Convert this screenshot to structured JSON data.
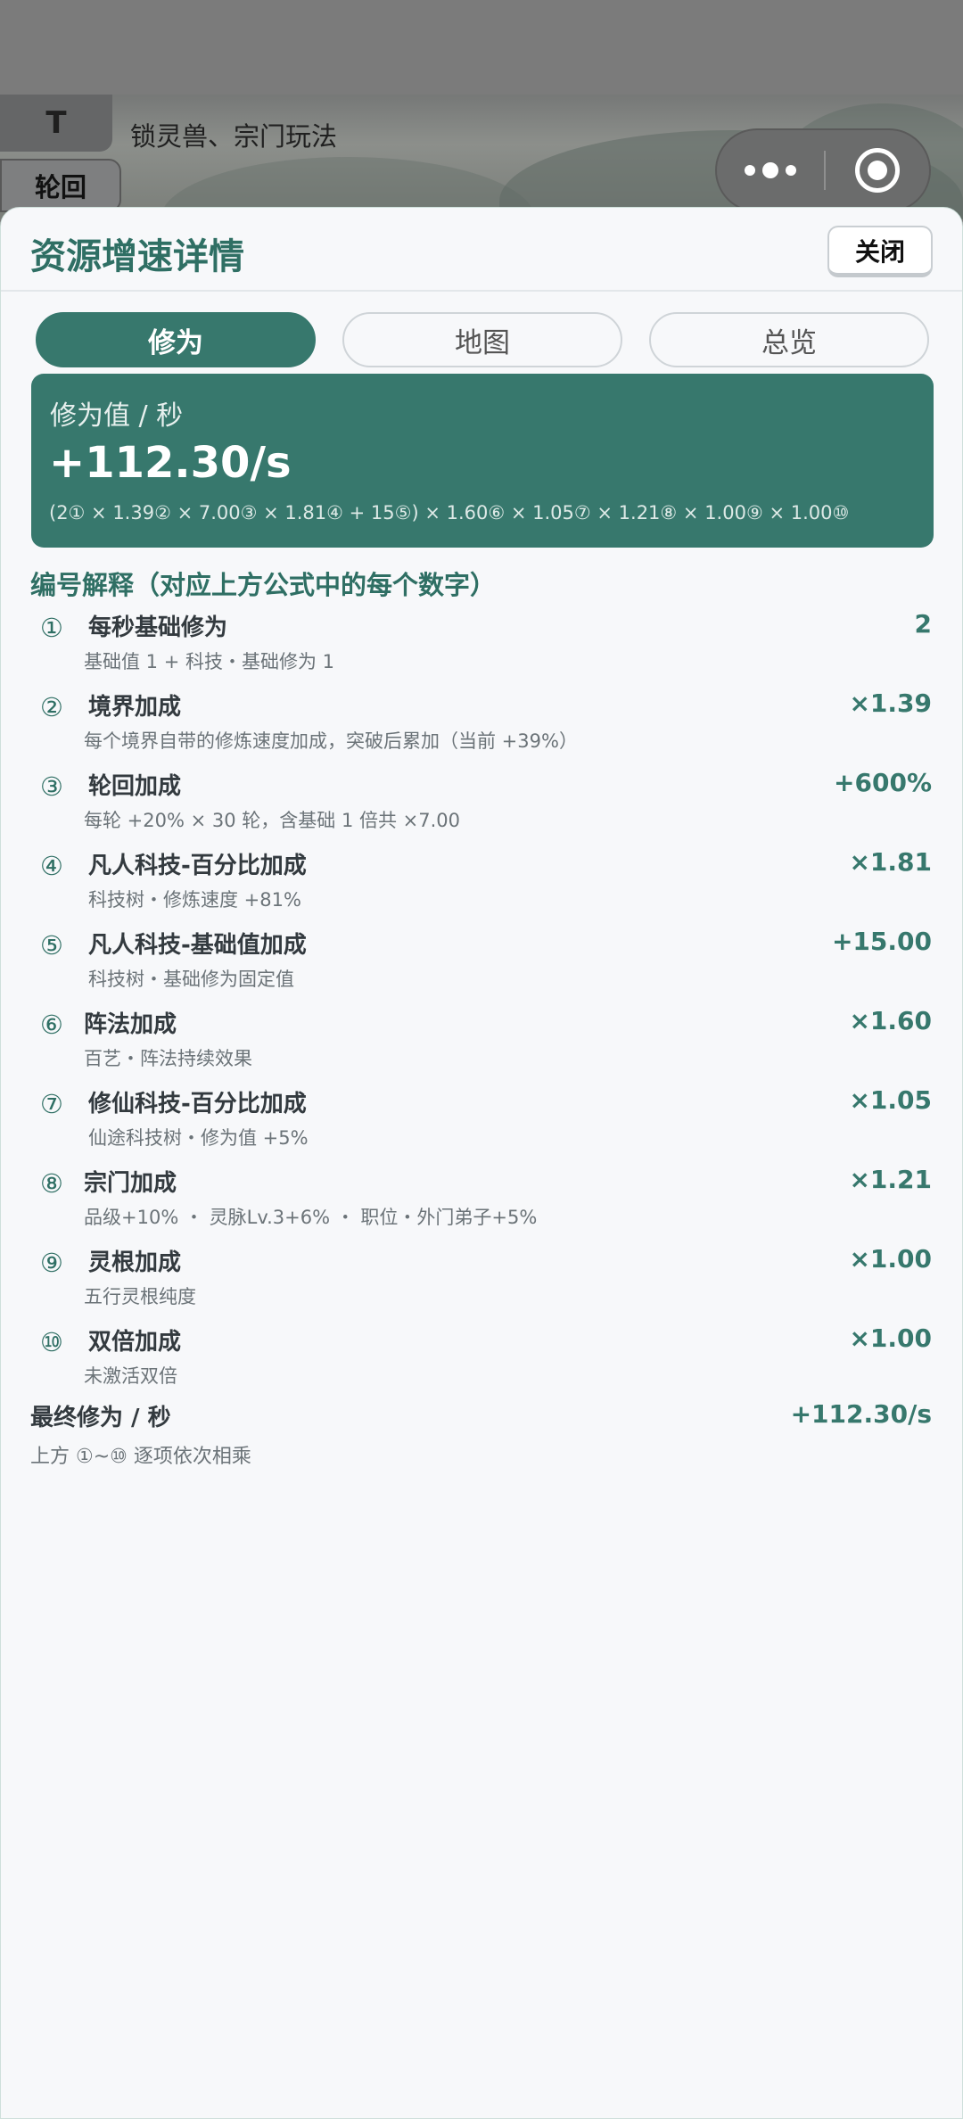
{
  "game_header": {
    "t_tab_label": "T",
    "message": "锁灵兽、宗门玩法",
    "lunhui_tab_label": "轮回"
  },
  "capsule": {
    "more_icon": "more-dots-icon",
    "close_icon": "target-circle-icon"
  },
  "sheet": {
    "title": "资源增速详情",
    "close_label": "关闭"
  },
  "tabs": [
    {
      "label": "修为",
      "active": true
    },
    {
      "label": "地图",
      "active": false
    },
    {
      "label": "总览",
      "active": false
    }
  ],
  "formula_card": {
    "label": "修为值 / 秒",
    "value": "+112.30/s",
    "formula": "(2① × 1.39② × 7.00③ × 1.81④ + 15⑤) × 1.60⑥ × 1.05⑦ × 1.21⑧ × 1.00⑨ × 1.00⑩"
  },
  "explanation": {
    "title": "编号解释（对应上方公式中的每个数字）",
    "items": [
      {
        "num": "①",
        "name": "每秒基础修为",
        "desc": "基础值 1 + 科技・基础修为 1",
        "value": "2"
      },
      {
        "num": "②",
        "name": "境界加成",
        "desc": "每个境界自带的修炼速度加成，突破后累加（当前 +39%）",
        "value": "×1.39"
      },
      {
        "num": "③",
        "name": "轮回加成",
        "desc": "每轮 +20% × 30 轮，含基础 1 倍共 ×7.00",
        "value": "+600%"
      },
      {
        "num": "④",
        "name": "凡人科技-百分比加成",
        "desc": "科技树・修炼速度 +81%",
        "value": "×1.81"
      },
      {
        "num": "⑤",
        "name": "凡人科技-基础值加成",
        "desc": "科技树・基础修为固定值",
        "value": "+15.00"
      },
      {
        "num": "⑥",
        "name": "阵法加成",
        "desc": "百艺・阵法持续效果",
        "value": "×1.60"
      },
      {
        "num": "⑦",
        "name": "修仙科技-百分比加成",
        "desc": "仙途科技树・修为值 +5%",
        "value": "×1.05"
      },
      {
        "num": "⑧",
        "name": "宗门加成",
        "desc": "品级+10% ・ 灵脉Lv.3+6% ・ 职位・外门弟子+5%",
        "value": "×1.21"
      },
      {
        "num": "⑨",
        "name": "灵根加成",
        "desc": "五行灵根纯度",
        "value": "×1.00"
      },
      {
        "num": "⑩",
        "name": "双倍加成",
        "desc": "未激活双倍",
        "value": "×1.00"
      }
    ]
  },
  "final": {
    "label": "最终修为 / 秒",
    "value": "+112.30/s",
    "note": "上方 ①~⑩ 逐项依次相乘"
  },
  "colors": {
    "accent": "#37786d",
    "title_green": "#2f6f64",
    "sheet_bg": "#f7f8fa"
  }
}
